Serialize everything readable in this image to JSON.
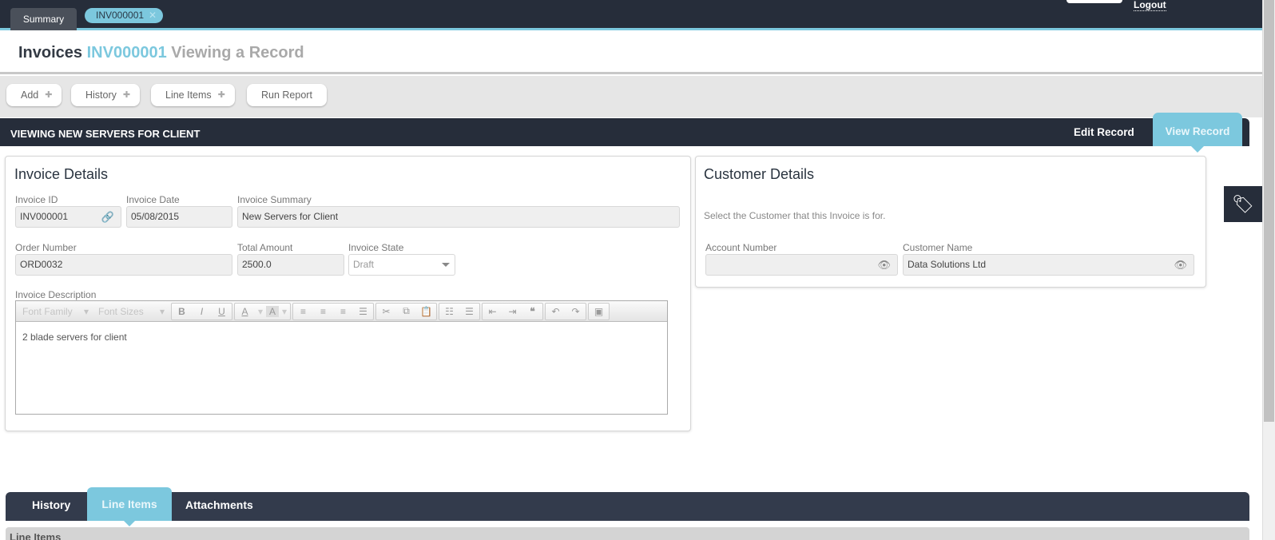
{
  "topbar": {
    "tabs": [
      {
        "label": "Summary"
      },
      {
        "label": "INV000001",
        "close_icon": "close-icon"
      }
    ],
    "logout_label": "Logout"
  },
  "title": {
    "module": "Invoices",
    "record_id": "INV000001",
    "mode": "Viewing a Record"
  },
  "toolbar": {
    "buttons": [
      {
        "label": "Add",
        "icon": "down-arrow-icon"
      },
      {
        "label": "History",
        "icon": "down-arrow-icon"
      },
      {
        "label": "Line Items",
        "icon": "down-arrow-icon"
      },
      {
        "label": "Run Report"
      }
    ]
  },
  "section": {
    "title": "VIEWING NEW SERVERS FOR CLIENT",
    "edit_label": "Edit Record",
    "view_label": "View Record"
  },
  "invoice_details": {
    "title": "Invoice Details",
    "invoice_id_label": "Invoice ID",
    "invoice_id": "INV000001",
    "invoice_date_label": "Invoice Date",
    "invoice_date": "05/08/2015",
    "summary_label": "Invoice Summary",
    "summary": "New Servers for Client",
    "order_number_label": "Order Number",
    "order_number": "ORD0032",
    "total_amount_label": "Total Amount",
    "total_amount": "2500.0",
    "state_label": "Invoice State",
    "state": "Draft",
    "description_label": "Invoice Description",
    "description": "2 blade servers for client",
    "editor": {
      "font_family": "Font Family",
      "font_sizes": "Font Sizes",
      "bold": "B",
      "italic": "I",
      "underline": "U",
      "text_color": "A",
      "bg_color": "A"
    }
  },
  "customer_details": {
    "title": "Customer Details",
    "help": "Select the Customer that this Invoice is for.",
    "account_number_label": "Account Number",
    "account_number": "",
    "customer_name_label": "Customer Name",
    "customer_name": "Data Solutions Ltd"
  },
  "bottom_tabs": {
    "tabs": [
      {
        "label": "History"
      },
      {
        "label": "Line Items",
        "active": true
      },
      {
        "label": "Attachments"
      }
    ],
    "sub_title": "Line Items"
  },
  "colors": {
    "dark": "#262d3a",
    "accent": "#7cc8de"
  }
}
